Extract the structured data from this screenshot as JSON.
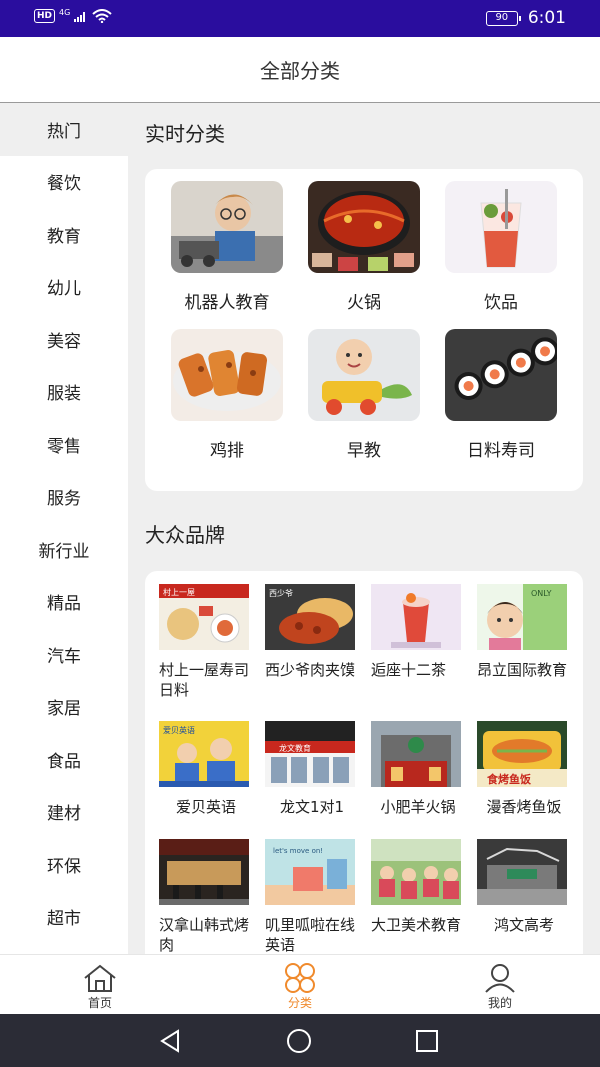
{
  "status_bar": {
    "hd": "HD",
    "network": "4G",
    "battery": "90",
    "time": "6:01"
  },
  "header": {
    "title": "全部分类"
  },
  "sidebar": {
    "items": [
      {
        "label": "热门",
        "active": true
      },
      {
        "label": "餐饮"
      },
      {
        "label": "教育"
      },
      {
        "label": "幼儿"
      },
      {
        "label": "美容"
      },
      {
        "label": "服装"
      },
      {
        "label": "零售"
      },
      {
        "label": "服务"
      },
      {
        "label": "新行业"
      },
      {
        "label": "精品"
      },
      {
        "label": "汽车"
      },
      {
        "label": "家居"
      },
      {
        "label": "食品"
      },
      {
        "label": "建材"
      },
      {
        "label": "环保"
      },
      {
        "label": "超市"
      }
    ]
  },
  "realtime": {
    "title": "实时分类",
    "items": [
      {
        "label": "机器人教育"
      },
      {
        "label": "火锅"
      },
      {
        "label": "饮品"
      },
      {
        "label": "鸡排"
      },
      {
        "label": "早教"
      },
      {
        "label": "日料寿司"
      }
    ]
  },
  "brands": {
    "title": "大众品牌",
    "items": [
      {
        "label": "村上一屋寿司日料",
        "img_text": "村上一屋"
      },
      {
        "label": "西少爷肉夹馍",
        "img_text": "西少爷"
      },
      {
        "label": "逅座十二茶"
      },
      {
        "label": "昂立国际教育",
        "img_text": "ONLY"
      },
      {
        "label": "爱贝英语",
        "img_text": "爱贝英语"
      },
      {
        "label": "龙文1对1",
        "img_text": "龙文教育"
      },
      {
        "label": "小肥羊火锅"
      },
      {
        "label": "漫香烤鱼饭",
        "img_text": "食烤鱼饭"
      },
      {
        "label": "汉拿山韩式烤肉"
      },
      {
        "label": "叽里呱啦在线英语",
        "img_text": "let's move on!"
      },
      {
        "label": "大卫美术教育"
      },
      {
        "label": "鸿文高考"
      }
    ]
  },
  "tabbar": {
    "items": [
      {
        "label": "首页",
        "icon": "home-icon"
      },
      {
        "label": "分类",
        "icon": "category-icon",
        "active": true
      },
      {
        "label": "我的",
        "icon": "user-icon"
      }
    ]
  },
  "colors": {
    "status_bar": "#2a0d9e",
    "accent": "#f08a2c",
    "nav_bar": "#2b2c36",
    "background": "#efefef"
  }
}
